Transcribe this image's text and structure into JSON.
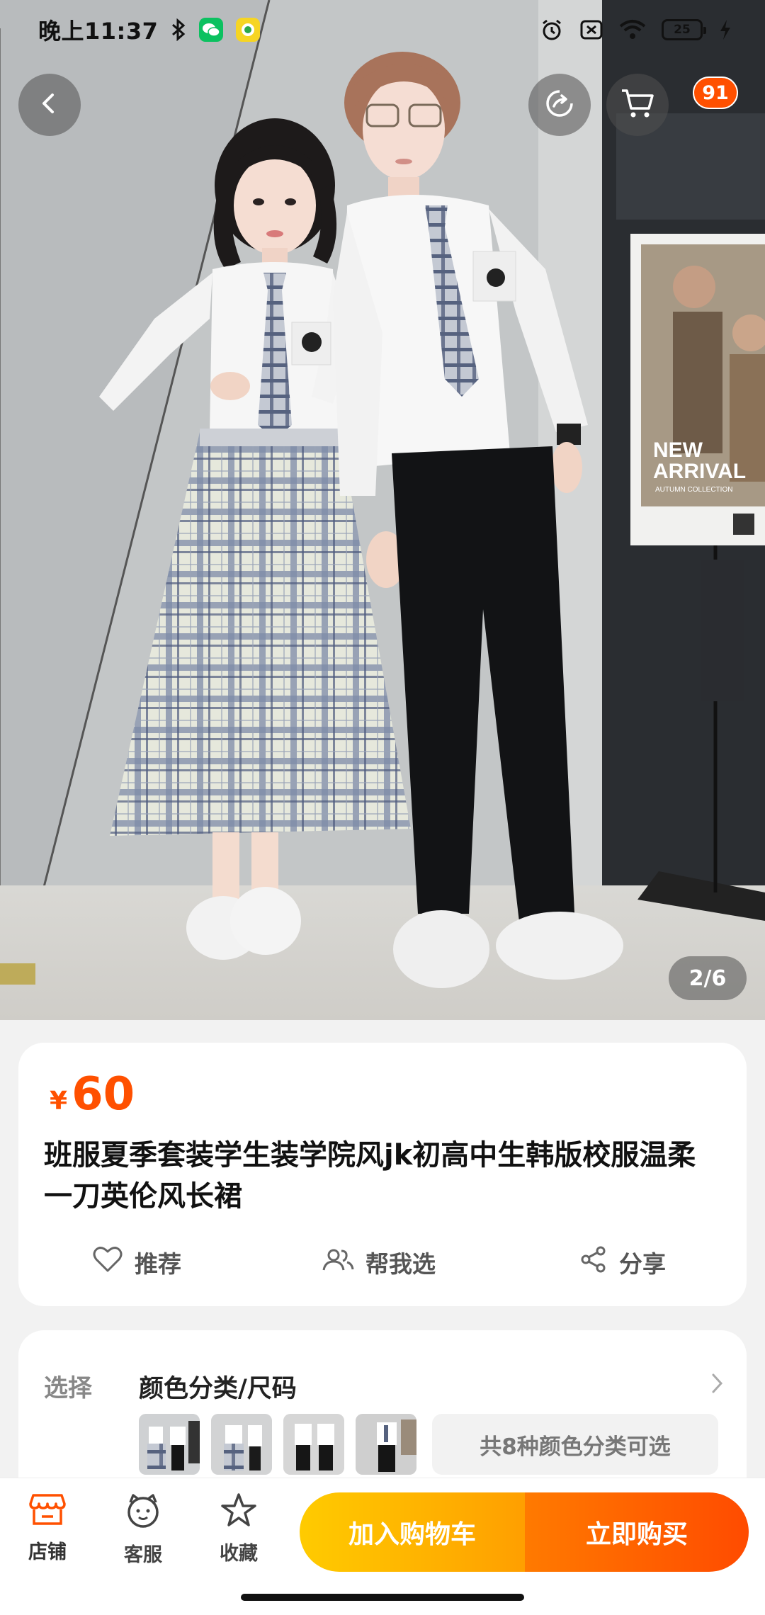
{
  "status_bar": {
    "time": "晚上11:37",
    "battery": "25",
    "icons": [
      "bluetooth-icon",
      "wechat-icon",
      "app-notification-icon",
      "alarm-icon",
      "sim-off-icon",
      "wifi-icon",
      "battery-icon",
      "charging-icon"
    ]
  },
  "top_nav": {
    "icons": [
      "back-arrow-icon",
      "share-arrow-icon",
      "cart-icon"
    ],
    "cart_count": "91"
  },
  "gallery": {
    "page_indicator": "2/6",
    "poster_text_1": "NEW",
    "poster_text_2": "ARRIVAL",
    "poster_text_3": "AUTUMN COLLECTION"
  },
  "product": {
    "currency": "¥",
    "price": "60",
    "title": "班服夏季套装学生装学院风jk初高中生韩版校服温柔一刀英伦风长裙",
    "actions": {
      "recommend": "推荐",
      "help_choose": "帮我选",
      "share": "分享"
    }
  },
  "selection": {
    "label": "选择",
    "title": "颜色分类/尺码",
    "more_options": "共8种颜色分类可选"
  },
  "bottom_bar": {
    "store": "店铺",
    "service": "客服",
    "favorite": "收藏",
    "add_to_cart": "加入购物车",
    "buy_now": "立即购买"
  },
  "colors": {
    "accent": "#ff5000",
    "cart_button_start": "#ffcb00",
    "buy_button_end": "#ff4b00"
  }
}
